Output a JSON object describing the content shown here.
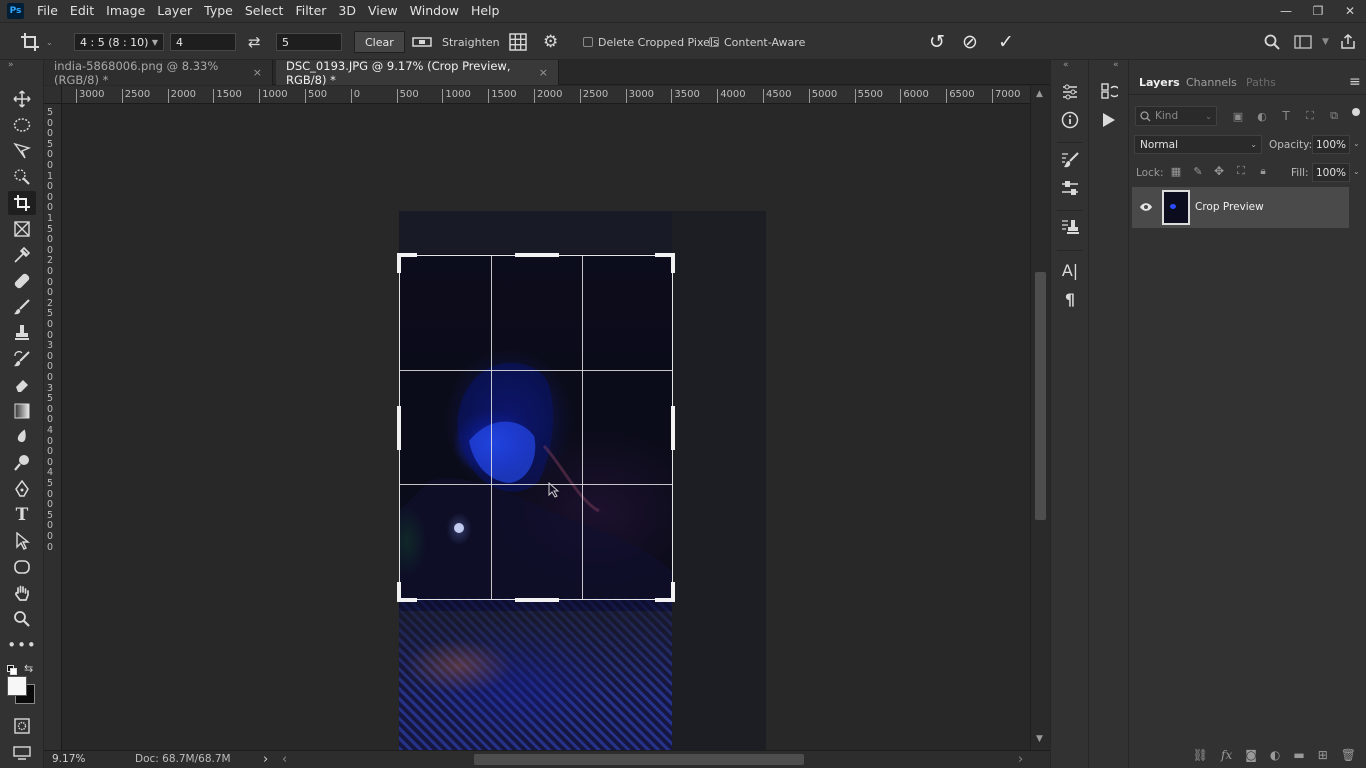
{
  "app": {
    "logo": "Ps"
  },
  "menu": [
    "File",
    "Edit",
    "Image",
    "Layer",
    "Type",
    "Select",
    "Filter",
    "3D",
    "View",
    "Window",
    "Help"
  ],
  "window_controls": {
    "minimize": "—",
    "restore": "❐",
    "close": "✕"
  },
  "options": {
    "ratio_preset": "4 : 5 (8 : 10)",
    "width_value": "4",
    "height_value": "5",
    "swap_icon": "⇄",
    "clear_label": "Clear",
    "straighten_label": "Straighten",
    "delete_cropped_label": "Delete Cropped Pixels",
    "content_aware_label": "Content-Aware",
    "reset_icon": "↺",
    "cancel_icon": "⊘",
    "commit_icon": "✓"
  },
  "tabs": [
    {
      "label": "india-5868006.png @ 8.33% (RGB/8) *",
      "close": "×"
    },
    {
      "label": "DSC_0193.JPG @ 9.17% (Crop Preview, RGB/8) *",
      "close": "×"
    }
  ],
  "ruler_top_labels": [
    "3000",
    "2500",
    "2000",
    "1500",
    "1000",
    "500",
    "0",
    "500",
    "1000",
    "1500",
    "2000",
    "2500",
    "3000",
    "3500",
    "4000",
    "4500",
    "5000",
    "5500",
    "6000",
    "6500",
    "7000"
  ],
  "ruler_left_labels": [
    "5",
    "0",
    "0",
    "5",
    "0",
    "0",
    "1",
    "0",
    "0",
    "0",
    "1",
    "5",
    "0",
    "0",
    "2",
    "0",
    "0",
    "0",
    "2",
    "5",
    "0",
    "0",
    "3",
    "0",
    "0",
    "0",
    "3",
    "5",
    "0",
    "0",
    "4",
    "0",
    "0",
    "0",
    "4",
    "5",
    "0",
    "0",
    "5",
    "0",
    "0",
    "0"
  ],
  "status": {
    "zoom": "9.17%",
    "doc": "Doc: 68.7M/68.7M",
    "arrow": "›",
    "scroll_left": "‹",
    "scroll_right": "›"
  },
  "layers_panel": {
    "tabs": [
      "Layers",
      "Channels",
      "Paths"
    ],
    "kind_label": "Kind",
    "blend_mode": "Normal",
    "opacity_label": "Opacity:",
    "opacity_value": "100%",
    "lock_label": "Lock:",
    "fill_label": "Fill:",
    "fill_value": "100%",
    "layers": [
      {
        "name": "Crop Preview",
        "visible": true
      }
    ],
    "menu_icon": "≡"
  },
  "colors": {
    "accent": "#31a8ff",
    "crop_overlay": "#e6e6e6",
    "panel_bg": "#323232"
  }
}
